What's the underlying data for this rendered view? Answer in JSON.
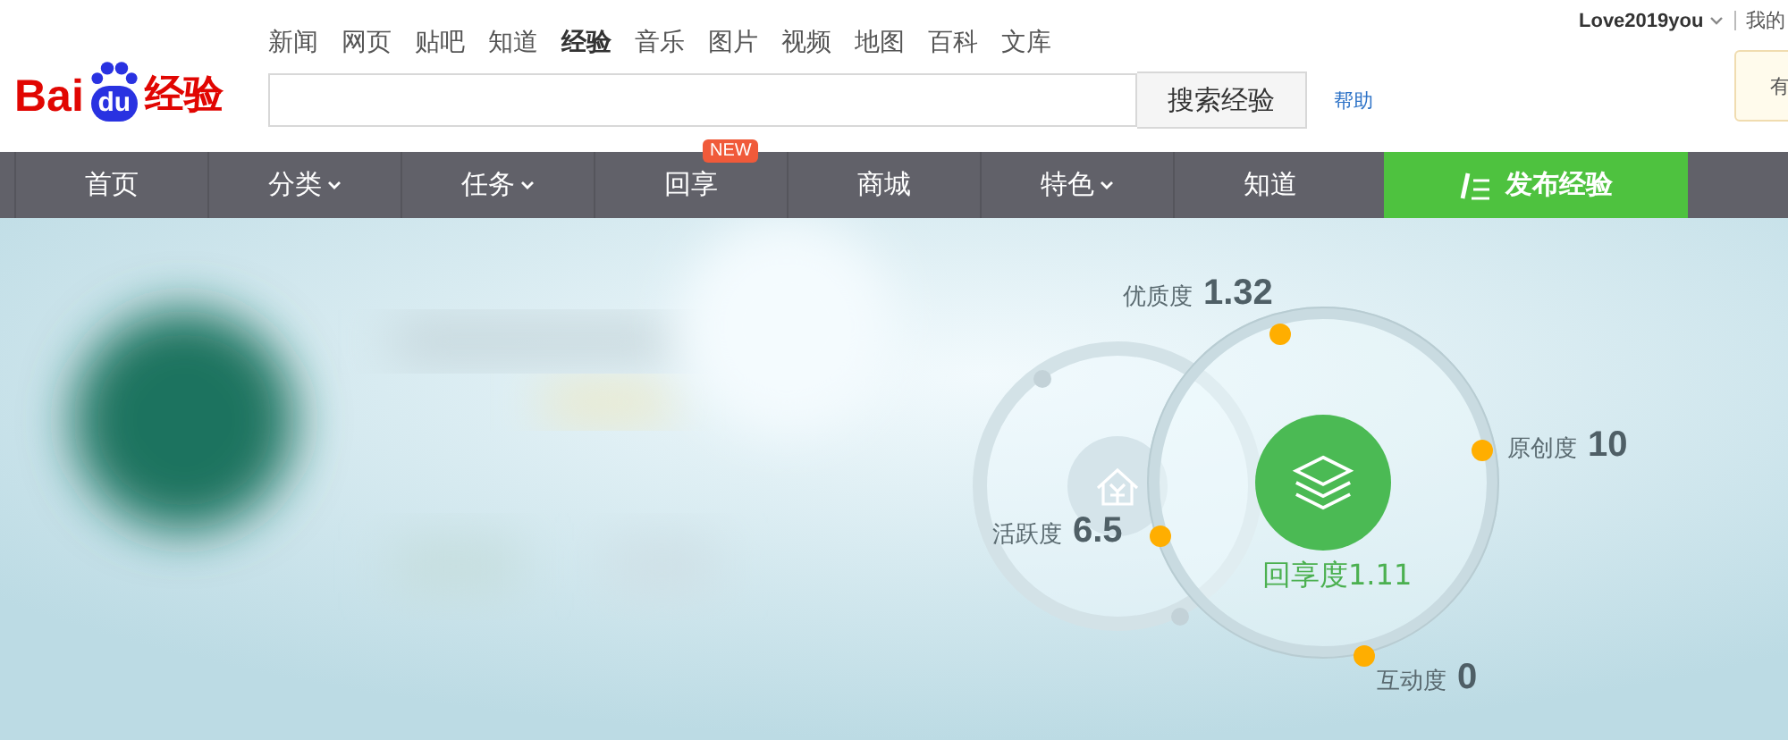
{
  "logo": {
    "text": "Bai",
    "badge": "du",
    "suffix": "经验"
  },
  "top_links": [
    {
      "label": "新闻",
      "selected": false
    },
    {
      "label": "网页",
      "selected": false
    },
    {
      "label": "贴吧",
      "selected": false
    },
    {
      "label": "知道",
      "selected": false
    },
    {
      "label": "经验",
      "selected": true
    },
    {
      "label": "音乐",
      "selected": false
    },
    {
      "label": "图片",
      "selected": false
    },
    {
      "label": "视频",
      "selected": false
    },
    {
      "label": "地图",
      "selected": false
    },
    {
      "label": "百科",
      "selected": false
    },
    {
      "label": "文库",
      "selected": false
    }
  ],
  "search": {
    "button": "搜索经验",
    "help": "帮助"
  },
  "user": {
    "name": "Love2019you",
    "menu": "我的",
    "tooltip": "有"
  },
  "nav": [
    {
      "label": "首页",
      "dropdown": false
    },
    {
      "label": "分类",
      "dropdown": true
    },
    {
      "label": "任务",
      "dropdown": true
    },
    {
      "label": "回享",
      "dropdown": false,
      "badge": "NEW"
    },
    {
      "label": "商城",
      "dropdown": false
    },
    {
      "label": "特色",
      "dropdown": true
    },
    {
      "label": "知道",
      "dropdown": false
    }
  ],
  "publish_button": "发布经验",
  "stats": [
    {
      "kind": "metric",
      "label": "优质度",
      "value": "1.32"
    },
    {
      "kind": "metric",
      "label": "原创度",
      "value": "10"
    },
    {
      "kind": "metric",
      "label": "活跃度",
      "value": "6.5"
    },
    {
      "kind": "main",
      "label": "回享度",
      "value": "1.11"
    },
    {
      "kind": "metric",
      "label": "互动度",
      "value": "0"
    }
  ]
}
